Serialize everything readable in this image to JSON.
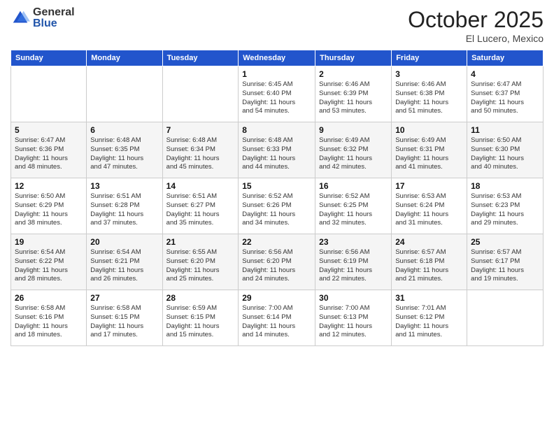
{
  "logo": {
    "general": "General",
    "blue": "Blue"
  },
  "header": {
    "month": "October 2025",
    "location": "El Lucero, Mexico"
  },
  "weekdays": [
    "Sunday",
    "Monday",
    "Tuesday",
    "Wednesday",
    "Thursday",
    "Friday",
    "Saturday"
  ],
  "weeks": [
    [
      {
        "day": "",
        "info": ""
      },
      {
        "day": "",
        "info": ""
      },
      {
        "day": "",
        "info": ""
      },
      {
        "day": "1",
        "info": "Sunrise: 6:45 AM\nSunset: 6:40 PM\nDaylight: 11 hours\nand 54 minutes."
      },
      {
        "day": "2",
        "info": "Sunrise: 6:46 AM\nSunset: 6:39 PM\nDaylight: 11 hours\nand 53 minutes."
      },
      {
        "day": "3",
        "info": "Sunrise: 6:46 AM\nSunset: 6:38 PM\nDaylight: 11 hours\nand 51 minutes."
      },
      {
        "day": "4",
        "info": "Sunrise: 6:47 AM\nSunset: 6:37 PM\nDaylight: 11 hours\nand 50 minutes."
      }
    ],
    [
      {
        "day": "5",
        "info": "Sunrise: 6:47 AM\nSunset: 6:36 PM\nDaylight: 11 hours\nand 48 minutes."
      },
      {
        "day": "6",
        "info": "Sunrise: 6:48 AM\nSunset: 6:35 PM\nDaylight: 11 hours\nand 47 minutes."
      },
      {
        "day": "7",
        "info": "Sunrise: 6:48 AM\nSunset: 6:34 PM\nDaylight: 11 hours\nand 45 minutes."
      },
      {
        "day": "8",
        "info": "Sunrise: 6:48 AM\nSunset: 6:33 PM\nDaylight: 11 hours\nand 44 minutes."
      },
      {
        "day": "9",
        "info": "Sunrise: 6:49 AM\nSunset: 6:32 PM\nDaylight: 11 hours\nand 42 minutes."
      },
      {
        "day": "10",
        "info": "Sunrise: 6:49 AM\nSunset: 6:31 PM\nDaylight: 11 hours\nand 41 minutes."
      },
      {
        "day": "11",
        "info": "Sunrise: 6:50 AM\nSunset: 6:30 PM\nDaylight: 11 hours\nand 40 minutes."
      }
    ],
    [
      {
        "day": "12",
        "info": "Sunrise: 6:50 AM\nSunset: 6:29 PM\nDaylight: 11 hours\nand 38 minutes."
      },
      {
        "day": "13",
        "info": "Sunrise: 6:51 AM\nSunset: 6:28 PM\nDaylight: 11 hours\nand 37 minutes."
      },
      {
        "day": "14",
        "info": "Sunrise: 6:51 AM\nSunset: 6:27 PM\nDaylight: 11 hours\nand 35 minutes."
      },
      {
        "day": "15",
        "info": "Sunrise: 6:52 AM\nSunset: 6:26 PM\nDaylight: 11 hours\nand 34 minutes."
      },
      {
        "day": "16",
        "info": "Sunrise: 6:52 AM\nSunset: 6:25 PM\nDaylight: 11 hours\nand 32 minutes."
      },
      {
        "day": "17",
        "info": "Sunrise: 6:53 AM\nSunset: 6:24 PM\nDaylight: 11 hours\nand 31 minutes."
      },
      {
        "day": "18",
        "info": "Sunrise: 6:53 AM\nSunset: 6:23 PM\nDaylight: 11 hours\nand 29 minutes."
      }
    ],
    [
      {
        "day": "19",
        "info": "Sunrise: 6:54 AM\nSunset: 6:22 PM\nDaylight: 11 hours\nand 28 minutes."
      },
      {
        "day": "20",
        "info": "Sunrise: 6:54 AM\nSunset: 6:21 PM\nDaylight: 11 hours\nand 26 minutes."
      },
      {
        "day": "21",
        "info": "Sunrise: 6:55 AM\nSunset: 6:20 PM\nDaylight: 11 hours\nand 25 minutes."
      },
      {
        "day": "22",
        "info": "Sunrise: 6:56 AM\nSunset: 6:20 PM\nDaylight: 11 hours\nand 24 minutes."
      },
      {
        "day": "23",
        "info": "Sunrise: 6:56 AM\nSunset: 6:19 PM\nDaylight: 11 hours\nand 22 minutes."
      },
      {
        "day": "24",
        "info": "Sunrise: 6:57 AM\nSunset: 6:18 PM\nDaylight: 11 hours\nand 21 minutes."
      },
      {
        "day": "25",
        "info": "Sunrise: 6:57 AM\nSunset: 6:17 PM\nDaylight: 11 hours\nand 19 minutes."
      }
    ],
    [
      {
        "day": "26",
        "info": "Sunrise: 6:58 AM\nSunset: 6:16 PM\nDaylight: 11 hours\nand 18 minutes."
      },
      {
        "day": "27",
        "info": "Sunrise: 6:58 AM\nSunset: 6:15 PM\nDaylight: 11 hours\nand 17 minutes."
      },
      {
        "day": "28",
        "info": "Sunrise: 6:59 AM\nSunset: 6:15 PM\nDaylight: 11 hours\nand 15 minutes."
      },
      {
        "day": "29",
        "info": "Sunrise: 7:00 AM\nSunset: 6:14 PM\nDaylight: 11 hours\nand 14 minutes."
      },
      {
        "day": "30",
        "info": "Sunrise: 7:00 AM\nSunset: 6:13 PM\nDaylight: 11 hours\nand 12 minutes."
      },
      {
        "day": "31",
        "info": "Sunrise: 7:01 AM\nSunset: 6:12 PM\nDaylight: 11 hours\nand 11 minutes."
      },
      {
        "day": "",
        "info": ""
      }
    ]
  ]
}
